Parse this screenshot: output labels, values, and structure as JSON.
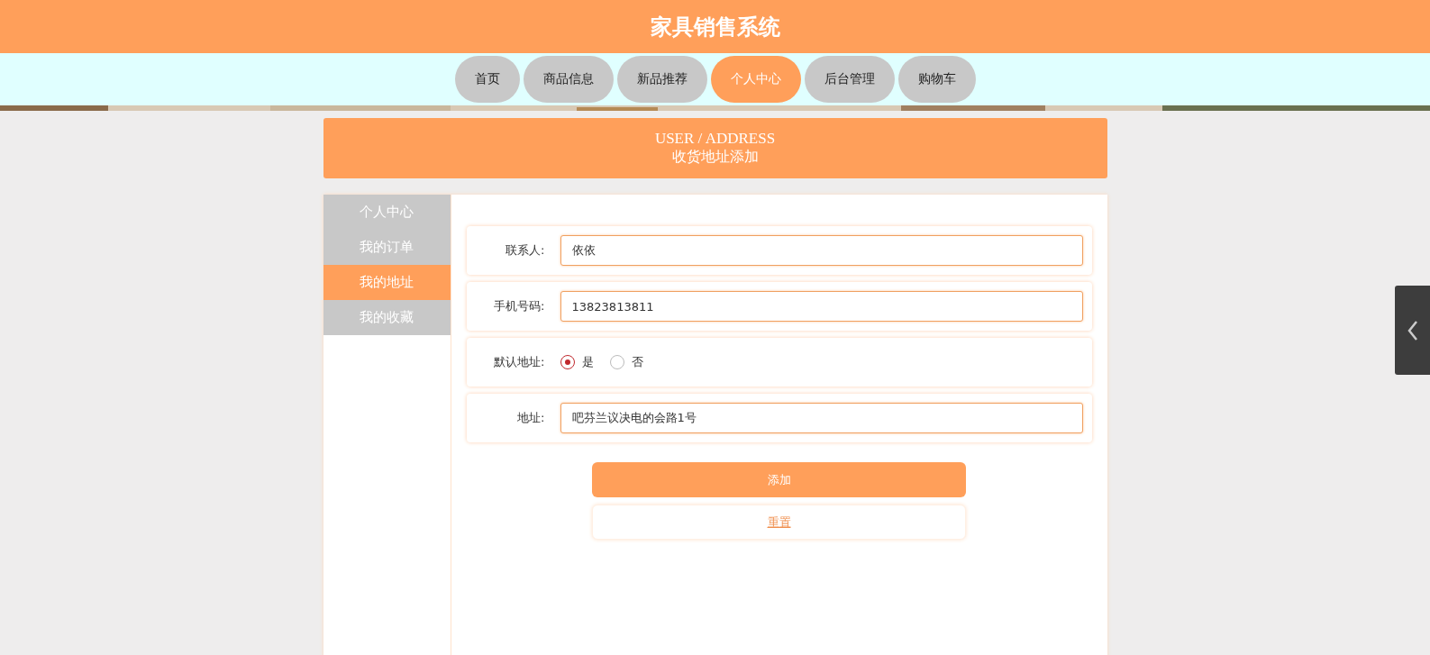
{
  "header": {
    "title": "家具销售系统"
  },
  "nav": [
    {
      "label": "首页",
      "selected": false
    },
    {
      "label": "商品信息",
      "selected": false
    },
    {
      "label": "新品推荐",
      "selected": false
    },
    {
      "label": "个人中心",
      "selected": true
    },
    {
      "label": "后台管理",
      "selected": false
    },
    {
      "label": "购物车",
      "selected": false
    }
  ],
  "banner": {
    "title": "USER / ADDRESS",
    "subtitle": "收货地址添加"
  },
  "sidebar": {
    "items": [
      {
        "label": "个人中心",
        "selected": false
      },
      {
        "label": "我的订单",
        "selected": false
      },
      {
        "label": "我的地址",
        "selected": true
      },
      {
        "label": "我的收藏",
        "selected": false
      }
    ]
  },
  "form": {
    "fields": [
      {
        "kind": "text",
        "label": "联系人:",
        "value": "依依"
      },
      {
        "kind": "text",
        "label": "手机号码:",
        "value": "13823813811"
      },
      {
        "kind": "radio",
        "label": "默认地址:",
        "options": [
          {
            "label": "是",
            "selected": true
          },
          {
            "label": "否",
            "selected": false
          }
        ]
      },
      {
        "kind": "text",
        "label": "地址:",
        "value": "吧芬兰议决电的会路1号"
      }
    ],
    "buttons": [
      {
        "kind": "primary",
        "label": "添加"
      },
      {
        "kind": "secondary",
        "label": "重置"
      }
    ]
  }
}
